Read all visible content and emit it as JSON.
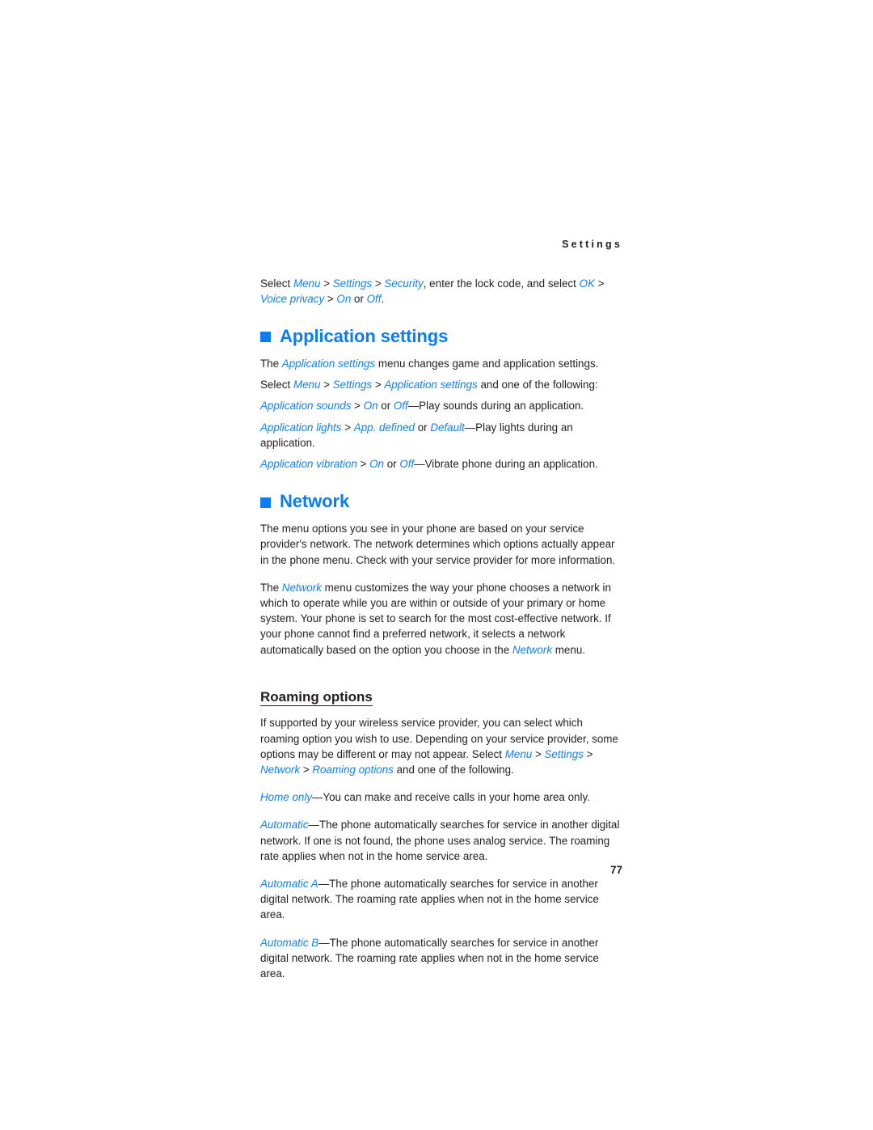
{
  "page": {
    "running_header": "Settings",
    "page_number": "77",
    "accent_color": "#0a7cf5",
    "text_color": "#231f20",
    "background_color": "#ffffff"
  },
  "intro": {
    "line": [
      {
        "t": "Select ",
        "s": "plain"
      },
      {
        "t": "Menu",
        "s": "ui"
      },
      {
        "t": " > ",
        "s": "plain"
      },
      {
        "t": "Settings",
        "s": "ui"
      },
      {
        "t": " > ",
        "s": "plain"
      },
      {
        "t": "Security",
        "s": "ui"
      },
      {
        "t": ", enter the lock code, and select ",
        "s": "plain"
      },
      {
        "t": "OK",
        "s": "ui"
      },
      {
        "t": " > ",
        "s": "plain"
      },
      {
        "t": "Voice privacy",
        "s": "ui"
      },
      {
        "t": " > ",
        "s": "plain"
      },
      {
        "t": "On",
        "s": "ui"
      },
      {
        "t": " or ",
        "s": "plain"
      },
      {
        "t": "Off",
        "s": "ui"
      },
      {
        "t": ".",
        "s": "plain"
      }
    ]
  },
  "sections": [
    {
      "id": "application-settings",
      "heading": "Application settings",
      "paragraphs": [
        [
          {
            "t": "The ",
            "s": "plain"
          },
          {
            "t": "Application settings",
            "s": "ui"
          },
          {
            "t": " menu changes game and application settings.",
            "s": "plain"
          }
        ],
        [
          {
            "t": "Select ",
            "s": "plain"
          },
          {
            "t": "Menu",
            "s": "ui"
          },
          {
            "t": " > ",
            "s": "plain"
          },
          {
            "t": "Settings",
            "s": "ui"
          },
          {
            "t": " > ",
            "s": "plain"
          },
          {
            "t": "Application settings",
            "s": "ui"
          },
          {
            "t": " and one of the following:",
            "s": "plain"
          }
        ],
        [
          {
            "t": "Application sounds",
            "s": "ui"
          },
          {
            "t": " > ",
            "s": "plain"
          },
          {
            "t": "On",
            "s": "ui"
          },
          {
            "t": " or ",
            "s": "plain"
          },
          {
            "t": "Off",
            "s": "ui"
          },
          {
            "t": "—Play sounds during an application.",
            "s": "plain"
          }
        ],
        [
          {
            "t": "Application lights",
            "s": "ui"
          },
          {
            "t": " > ",
            "s": "plain"
          },
          {
            "t": "App. defined",
            "s": "ui"
          },
          {
            "t": " or ",
            "s": "plain"
          },
          {
            "t": "Default",
            "s": "ui"
          },
          {
            "t": "—Play lights during an application.",
            "s": "plain"
          }
        ],
        [
          {
            "t": "Application vibration",
            "s": "ui"
          },
          {
            "t": " > ",
            "s": "plain"
          },
          {
            "t": "On",
            "s": "ui"
          },
          {
            "t": " or ",
            "s": "plain"
          },
          {
            "t": "Off",
            "s": "ui"
          },
          {
            "t": "—Vibrate phone during an application.",
            "s": "plain"
          }
        ]
      ]
    },
    {
      "id": "network",
      "heading": "Network",
      "paragraphs": [
        [
          {
            "t": "The menu options you see in your phone are based on your service provider's network. The network determines which options actually appear in the phone menu. Check with your service provider for more information.",
            "s": "plain"
          }
        ],
        [
          {
            "t": "The ",
            "s": "plain"
          },
          {
            "t": "Network",
            "s": "ui"
          },
          {
            "t": " menu customizes the way your phone chooses a network in which to operate while you are within or outside of your primary or home system. Your phone is set to search for the most cost-effective network. If your phone cannot find a preferred network, it selects a network automatically based on the option you choose in the ",
            "s": "plain"
          },
          {
            "t": "Network",
            "s": "ui"
          },
          {
            "t": " menu.",
            "s": "plain"
          }
        ]
      ],
      "subsection": {
        "id": "roaming-options",
        "heading": "Roaming options",
        "paragraphs": [
          [
            {
              "t": "If supported by your wireless service provider, you can select which roaming option you wish to use. Depending on your service provider, some options may be different or may not appear. Select ",
              "s": "plain"
            },
            {
              "t": "Menu",
              "s": "ui"
            },
            {
              "t": " > ",
              "s": "plain"
            },
            {
              "t": "Settings",
              "s": "ui"
            },
            {
              "t": " > ",
              "s": "plain"
            },
            {
              "t": "Network",
              "s": "ui"
            },
            {
              "t": " > ",
              "s": "plain"
            },
            {
              "t": "Roaming options",
              "s": "ui"
            },
            {
              "t": " and one of the following.",
              "s": "plain"
            }
          ],
          [
            {
              "t": "Home only",
              "s": "ui"
            },
            {
              "t": "—You can make and receive calls in your home area only.",
              "s": "plain"
            }
          ],
          [
            {
              "t": "Automatic",
              "s": "ui"
            },
            {
              "t": "—The phone automatically searches for service in another digital network. If one is not found, the phone uses analog service. The roaming rate applies when not in the home service area.",
              "s": "plain"
            }
          ],
          [
            {
              "t": "Automatic A",
              "s": "ui"
            },
            {
              "t": "—The phone automatically searches for service in another digital network. The roaming rate applies when not in the home service area.",
              "s": "plain"
            }
          ],
          [
            {
              "t": "Automatic B",
              "s": "ui"
            },
            {
              "t": "—The phone automatically searches for service in another digital network. The roaming rate applies when not in the home service area.",
              "s": "plain"
            }
          ]
        ]
      }
    }
  ]
}
